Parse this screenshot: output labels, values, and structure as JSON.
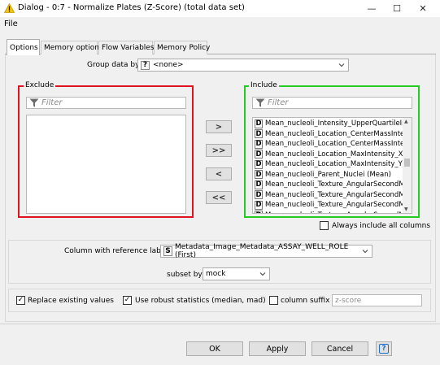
{
  "window": {
    "title": "Dialog - 0:7 - Normalize Plates (Z-Score) (total data set)",
    "minimize_glyph": "—",
    "maximize_glyph": "☐",
    "close_glyph": "✕"
  },
  "menu": {
    "file": "File"
  },
  "tabs": [
    {
      "label": "Options",
      "active": true
    },
    {
      "label": "Memory options",
      "active": false
    },
    {
      "label": "Flow Variables",
      "active": false
    },
    {
      "label": "Memory Policy",
      "active": false
    }
  ],
  "group_by": {
    "label": "Group data by",
    "type_badge": "?",
    "value": "<none>"
  },
  "exclude": {
    "title": "Exclude",
    "filter_placeholder": "Filter",
    "border_color": "#e0141e",
    "items": []
  },
  "include": {
    "title": "Include",
    "filter_placeholder": "Filter",
    "border_color": "#22cc22",
    "type_badge": "D",
    "items": [
      "Mean_nucleoli_Intensity_UpperQuartileIn…",
      "Mean_nucleoli_Location_CenterMassInte…",
      "Mean_nucleoli_Location_CenterMassInte…",
      "Mean_nucleoli_Location_MaxIntensity_X_…",
      "Mean_nucleoli_Location_MaxIntensity_Y_…",
      "Mean_nucleoli_Parent_Nuclei (Mean)",
      "Mean_nucleoli_Texture_AngularSecondM…",
      "Mean_nucleoli_Texture_AngularSecondM…",
      "Mean_nucleoli_Texture_AngularSecondM…",
      "Mean_nucleoli_Texture_AngularSecondM…"
    ],
    "always_include_label": "Always include all columns",
    "always_include_checked": false
  },
  "move_buttons": {
    "add": ">",
    "add_all": ">>",
    "remove": "<",
    "remove_all": "<<"
  },
  "reference": {
    "label": "Column with reference label",
    "type_badge": "S",
    "value": "Metadata_Image_Metadata_ASSAY_WELL_ROLE (First)"
  },
  "subset": {
    "label": "subset by:",
    "value": "mock"
  },
  "options": {
    "replace_label": "Replace existing values",
    "replace_checked": true,
    "robust_label": "Use robust statistics (median, mad)",
    "robust_checked": true,
    "suffix_label": "column suffix",
    "suffix_checked": false,
    "suffix_value": "z-score"
  },
  "buttons": {
    "ok": "OK",
    "apply": "Apply",
    "cancel": "Cancel",
    "help": "?"
  },
  "icons": {
    "app": "warning-triangle-icon",
    "filter": "filter-funnel-icon",
    "caret": "chevron-down-icon",
    "check": "✓"
  },
  "colors": {
    "accent": "#0078d7",
    "help": "#1f6fc5"
  }
}
